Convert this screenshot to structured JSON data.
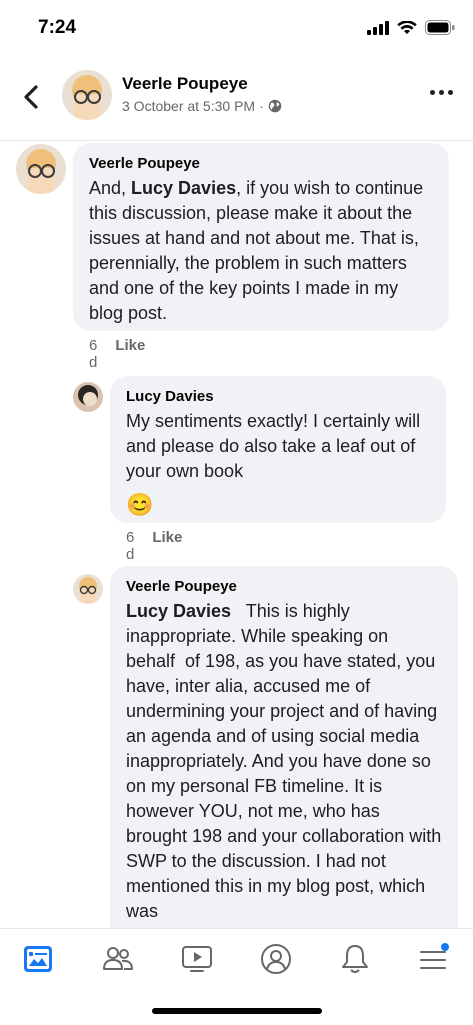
{
  "status": {
    "time": "7:24"
  },
  "header": {
    "name": "Veerle Poupeye",
    "date": "3 October at 5:30 PM",
    "separator": "·"
  },
  "comments": [
    {
      "name": "Veerle Poupeye",
      "text_prefix": "And, ",
      "mention": "Lucy Davies",
      "text": ", if you wish to continue this discussion, please make it about the issues at hand and not about me. That is, perennially, the problem in such matters and one of the key points I made in my blog post.",
      "age": "6 d",
      "like_label": "Like"
    },
    {
      "name": "Lucy Davies",
      "text": "My sentiments exactly! I certainly will and please do also take a leaf out of your own book",
      "emoji": "😊",
      "age": "6 d",
      "like_label": "Like"
    },
    {
      "name": "Veerle Poupeye",
      "mention": "Lucy Davies",
      "text": "   This is highly inappropriate. While speaking on behalf  of 198, as you have stated, you have, inter alia, accused me of undermining your project and of having an agenda and of using social media inappropriately. And you have done so on my personal FB timeline. It is however YOU, not me, who has brought 198 and your collaboration with SWP to the discussion. I had not mentioned this in my blog post, which was"
    }
  ],
  "nav": {
    "active_color": "#1877f2",
    "items": [
      "news-feed",
      "friends",
      "watch",
      "profile",
      "notifications",
      "menu"
    ]
  }
}
